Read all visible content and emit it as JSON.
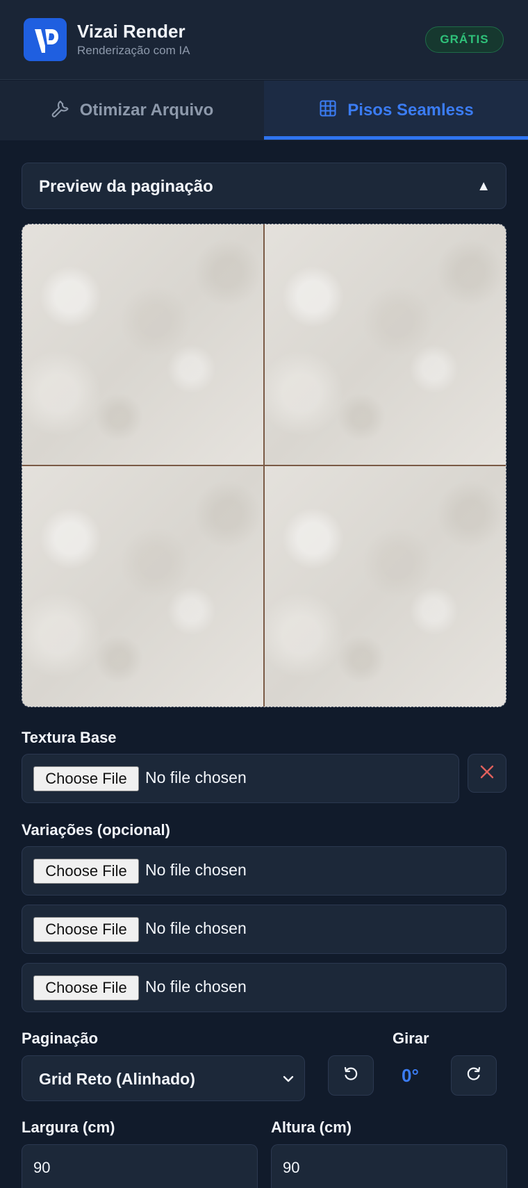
{
  "header": {
    "app_title": "Vizai Render",
    "app_subtitle": "Renderização com IA",
    "badge": "GRÁTIS",
    "logo_icon": "vizai-logo-icon"
  },
  "tabs": [
    {
      "label": "Otimizar Arquivo",
      "icon": "wrench-icon",
      "active": false
    },
    {
      "label": "Pisos Seamless",
      "icon": "grid-icon",
      "active": true
    }
  ],
  "colors": {
    "accent": "#2f74f0",
    "badge_text": "#2fc27a",
    "background": "#111b2b",
    "clear": "#e0605c"
  },
  "preview_section": {
    "title": "Preview da paginação",
    "caret": "▲"
  },
  "texture_base": {
    "label": "Textura Base",
    "button": "Choose File",
    "status": "No file chosen"
  },
  "variations": {
    "label": "Variações (opcional)",
    "inputs": [
      {
        "button": "Choose File",
        "status": "No file chosen"
      },
      {
        "button": "Choose File",
        "status": "No file chosen"
      },
      {
        "button": "Choose File",
        "status": "No file chosen"
      }
    ]
  },
  "pagination": {
    "label": "Paginação",
    "selected": "Grid Reto (Alinhado)"
  },
  "rotate": {
    "label": "Girar",
    "value": "0°"
  },
  "dimensions": {
    "width_label": "Largura (cm)",
    "width_value": "90",
    "height_label": "Altura (cm)",
    "height_value": "90"
  }
}
